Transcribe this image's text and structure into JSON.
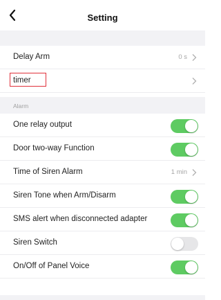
{
  "header": {
    "title": "Setting",
    "back_icon": "chevron-left-icon"
  },
  "general": {
    "delay_arm": {
      "label": "Delay Arm",
      "value": "0 s"
    },
    "timer": {
      "label": "timer"
    }
  },
  "alarm_section": {
    "label": "Alarm"
  },
  "alarm": {
    "one_relay": {
      "label": "One relay output",
      "on": true
    },
    "door_two_way": {
      "label": "Door two-way Function",
      "on": true
    },
    "siren_time": {
      "label": "Time of Siren Alarm",
      "value": "1 min"
    },
    "siren_tone": {
      "label": "Siren Tone when Arm/Disarm",
      "on": true
    },
    "sms_alert": {
      "label": "SMS alert when disconnected adapter",
      "on": true
    },
    "siren_switch": {
      "label": "Siren Switch",
      "on": false
    },
    "panel_voice": {
      "label": "On/Off of Panel Voice",
      "on": true
    }
  },
  "colors": {
    "toggle_on": "#5ecb62",
    "toggle_off": "#e6e6e8",
    "highlight": "#e0303a"
  }
}
